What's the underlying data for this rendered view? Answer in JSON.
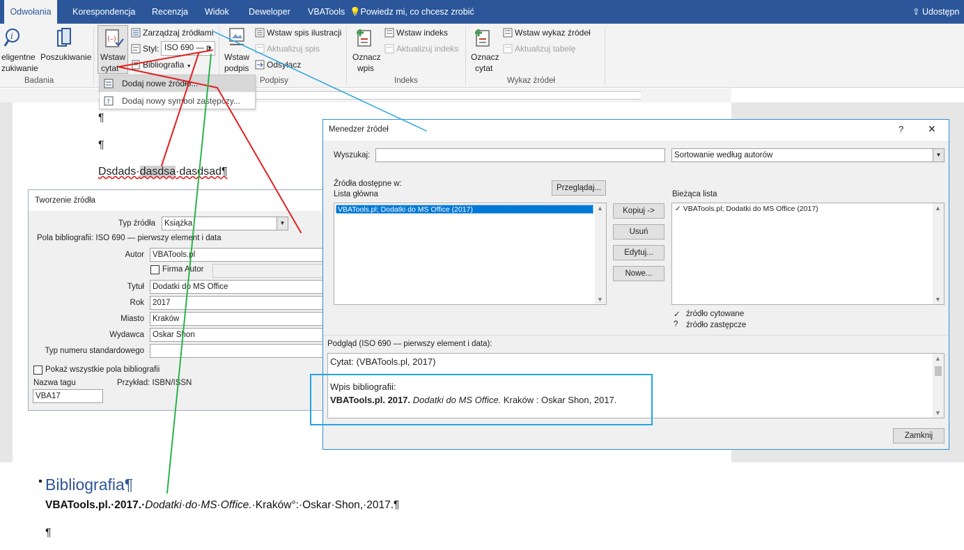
{
  "ribbon": {
    "tabs": [
      "Odwołania",
      "Korespondencja",
      "Recenzja",
      "Widok",
      "Deweloper",
      "VBATools"
    ],
    "active_tab": "Odwołania",
    "tell_me": "Powiedz mi, co chcesz zrobić",
    "share": "Udostępn",
    "research": {
      "smart_lookup_line1": "eligentne",
      "smart_lookup_line2": "zukiwanie",
      "researcher": "Poszukiwanie",
      "group": "Badania"
    },
    "citations": {
      "insert_citation_line1": "Wstaw",
      "insert_citation_line2": "cytat",
      "manage_sources": "Zarządzaj źródłami",
      "style_label": "Styl:",
      "style_value": "ISO 690 — p",
      "bibliography": "Bibliografia"
    },
    "captions": {
      "insert_caption_line1": "Wstaw",
      "insert_caption_line2": "podpis",
      "insert_table_of_figures": "Wstaw spis ilustracji",
      "update_table": "Aktualizuj spis",
      "cross_reference": "Odsyłacz",
      "group": "Podpisy"
    },
    "index": {
      "mark_entry_line1": "Oznacz",
      "mark_entry_line2": "wpis",
      "insert_index": "Wstaw indeks",
      "update_index": "Aktualizuj indeks",
      "group": "Indeks"
    },
    "authorities": {
      "mark_citation_line1": "Oznacz",
      "mark_citation_line2": "cytat",
      "insert_table": "Wstaw wykaz źródeł",
      "update_table": "Aktualizuj tabelę",
      "group": "Wykaz źródeł"
    }
  },
  "dropdown": {
    "add_new_source": "Dodaj nowe źródło...",
    "add_placeholder": "Dodaj nowy symbol zastępczy..."
  },
  "document": {
    "pilcrow": "¶",
    "line_text_prefix": "Dsdads·",
    "line_text_highlight": "dasdsa",
    "line_text_suffix": "·dasdsad¶",
    "bib_heading": "Bibliografia¶",
    "bib_entry_bold": "VBATools.pl.·2017.·",
    "bib_entry_italic": "Dodatki·do·MS·Office.",
    "bib_entry_rest": "·Kraków°:·Oskar·Shon,·2017.¶"
  },
  "create_source": {
    "title": "Tworzenie źródła",
    "type_label": "Typ źródła",
    "type_value": "Książka",
    "fields_header": "Pola bibliografii: ISO 690 — pierwszy element i data",
    "author_label": "Autor",
    "author_value": "VBATools.pl",
    "corporate_author_label": "Firma Autor",
    "title_label": "Tytuł",
    "title_value": "Dodatki do MS Office",
    "year_label": "Rok",
    "year_value": "2017",
    "city_label": "Miasto",
    "city_value": "Kraków",
    "publisher_label": "Wydawca",
    "publisher_value": "Oskar Shon",
    "standard_number_label": "Typ numeru standardowego",
    "standard_number_value": "",
    "show_all_fields": "Pokaż wszystkie pola bibliografii",
    "tag_name_label": "Nazwa tagu",
    "tag_name_value": "VBA17",
    "example": "Przykład: ISBN/ISSN"
  },
  "source_manager": {
    "title": "Menedzer źródeł",
    "help": "?",
    "close": "✕",
    "search_label": "Wyszukaj:",
    "search_value": "",
    "sort_value": "Sortowanie według autorów",
    "available_in": "Źródła dostępne w:",
    "master_list": "Lista główna",
    "browse": "Przeglądaj...",
    "current_list": "Bieżąca lista",
    "master_items": [
      "VBATools.pl; Dodatki do MS Office (2017)"
    ],
    "current_items": [
      "VBATools.pl; Dodatki do MS Office (2017)"
    ],
    "copy": "Kopiuj ->",
    "delete": "Usuń",
    "edit": "Edytuj...",
    "new": "Nowe...",
    "legend_cited": "źródło cytowane",
    "legend_placeholder": "źródło zastępcze",
    "check_mark": "✓",
    "question_mark": "?",
    "preview_label": "Podgląd (ISO 690 — pierwszy element i data):",
    "citation_preview": "Cytat:  (VBATools.pl, 2017)",
    "bibliography_entry_label": "Wpis bibliografii:",
    "bibliography_entry_bold": "VBATools.pl. 2017.",
    "bibliography_entry_italic": "Dodatki do MS Office.",
    "bibliography_entry_rest": "Kraków : Oskar Shon, 2017.",
    "close_button": "Zamknij"
  },
  "colors": {
    "ribbon_blue": "#2b579a",
    "annotation_red": "#e02020",
    "annotation_green": "#2ab24a",
    "annotation_blue": "#21a5e0",
    "heading_blue": "#2e5597",
    "selection_blue": "#0078d7"
  }
}
